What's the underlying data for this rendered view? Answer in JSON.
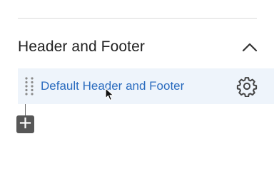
{
  "section": {
    "title": "Header and Footer",
    "collapse_icon": "chevron-up-icon"
  },
  "items": [
    {
      "label": "Default Header and Footer",
      "drag_icon": "drag-handle-icon",
      "settings_icon": "gear-icon"
    }
  ],
  "add_button": {
    "icon": "plus-icon"
  },
  "colors": {
    "link": "#2b6cbf",
    "row_background": "#eef4fb",
    "title": "#222222",
    "add_button": "#575757"
  }
}
